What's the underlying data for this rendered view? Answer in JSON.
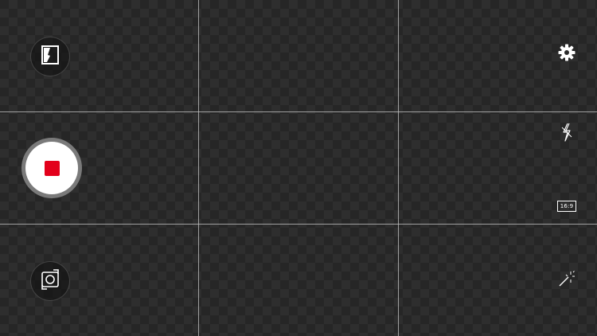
{
  "screen": {
    "mode": "video-recording",
    "accent_color": "#e3001b"
  },
  "left_controls": {
    "gallery": {
      "icon": "gallery-icon"
    },
    "record": {
      "icon": "stop-icon",
      "state": "recording"
    },
    "switch_camera": {
      "icon": "switch-camera-icon"
    }
  },
  "right_controls": {
    "settings": {
      "icon": "gear-icon"
    },
    "flash": {
      "icon": "flash-off-icon"
    },
    "aspect_ratio": {
      "icon": "aspect-ratio-icon",
      "label": "16:9"
    },
    "effects": {
      "icon": "magic-wand-icon"
    }
  }
}
